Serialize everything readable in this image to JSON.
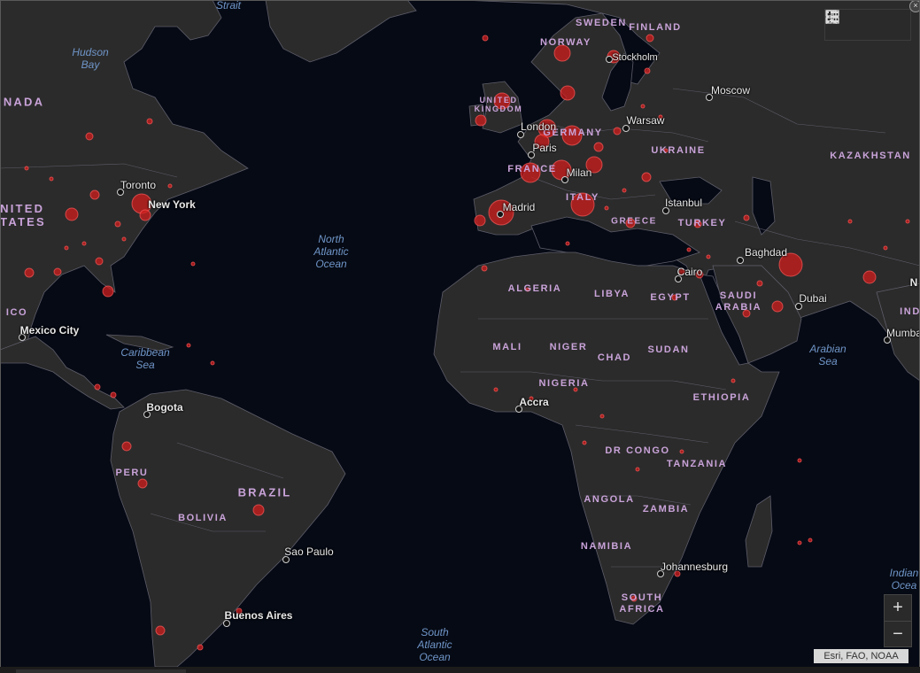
{
  "map": {
    "attribution": "Esri, FAO, NOAA",
    "colors": {
      "ocean": "#060a14",
      "land": "#2b2b2b",
      "border": "#5d5d6a",
      "bubble": "#d01d1d",
      "bubble_stroke": "#ff5a5a"
    },
    "toolbar": {
      "icons": [
        "bookmark-icon",
        "list-icon",
        "grid-icon"
      ]
    },
    "zoom": {
      "in_label": "+",
      "out_label": "−"
    },
    "close_label": "×",
    "oceans": [
      {
        "name": "Strait"
      },
      {
        "name": "Hudson\nBay"
      },
      {
        "name": "North\nAtlantic\nOcean"
      },
      {
        "name": "Caribbean\nSea"
      },
      {
        "name": "Arabian\nSea"
      },
      {
        "name": "South\nAtlantic\nOcean"
      },
      {
        "name": "Indian\nOcea"
      }
    ],
    "countries": [
      {
        "name": "SWEDEN"
      },
      {
        "name": "FINLAND"
      },
      {
        "name": "NORWAY"
      },
      {
        "name": "UNITED\nKINGDOM"
      },
      {
        "name": "GERMANY"
      },
      {
        "name": "FRANCE"
      },
      {
        "name": "ITALY"
      },
      {
        "name": "GREECE"
      },
      {
        "name": "UKRAINE"
      },
      {
        "name": "TURKEY"
      },
      {
        "name": "KAZAKHSTAN"
      },
      {
        "name": "NADA"
      },
      {
        "name": "NITED\nTATES"
      },
      {
        "name": "ICO"
      },
      {
        "name": "ALGERIA"
      },
      {
        "name": "LIBYA"
      },
      {
        "name": "EGYPT"
      },
      {
        "name": "SAUDI\nARABIA"
      },
      {
        "name": "IND"
      },
      {
        "name": "MALI"
      },
      {
        "name": "NIGER"
      },
      {
        "name": "CHAD"
      },
      {
        "name": "SUDAN"
      },
      {
        "name": "NIGERIA"
      },
      {
        "name": "ETHIOPIA"
      },
      {
        "name": "DR CONGO"
      },
      {
        "name": "TANZANIA"
      },
      {
        "name": "ANGOLA"
      },
      {
        "name": "ZAMBIA"
      },
      {
        "name": "NAMIBIA"
      },
      {
        "name": "SOUTH\nAFRICA"
      },
      {
        "name": "BRAZIL"
      },
      {
        "name": "BOLIVIA"
      },
      {
        "name": "PERU"
      }
    ],
    "cities": [
      {
        "name": "Stockholm"
      },
      {
        "name": "Moscow"
      },
      {
        "name": "Warsaw"
      },
      {
        "name": "London"
      },
      {
        "name": "Paris"
      },
      {
        "name": "Milan"
      },
      {
        "name": "Madrid"
      },
      {
        "name": "Istanbul"
      },
      {
        "name": "Baghdad"
      },
      {
        "name": "Cairo"
      },
      {
        "name": "Dubai"
      },
      {
        "name": "Mumba"
      },
      {
        "name": "N"
      },
      {
        "name": "Toronto"
      },
      {
        "name": "New York"
      },
      {
        "name": "Mexico City"
      },
      {
        "name": "Bogota"
      },
      {
        "name": "Accra"
      },
      {
        "name": "Sao Paulo"
      },
      {
        "name": "Buenos Aires"
      },
      {
        "name": "Johannesburg"
      }
    ]
  }
}
